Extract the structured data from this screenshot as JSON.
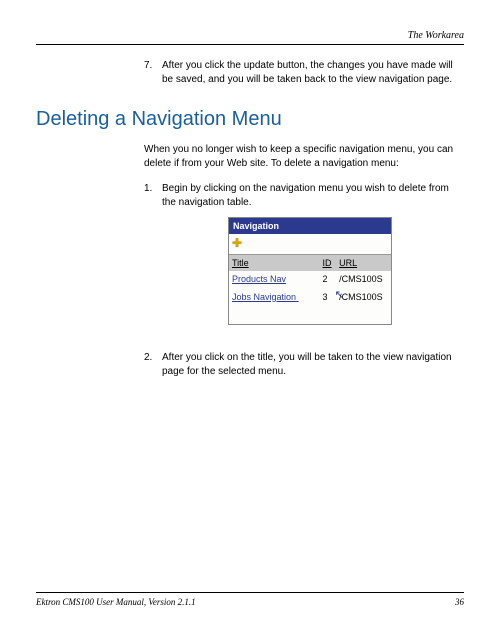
{
  "header": {
    "right_title": "The Workarea"
  },
  "step7": {
    "num": "7.",
    "text": "After you click the update button, the changes you have made will be saved, and you will be taken back to the view navigation page."
  },
  "heading": "Deleting a Navigation Menu",
  "intro": "When you no longer wish to keep a specific navigation menu, you can delete if from your Web site. To delete a navigation menu:",
  "step1": {
    "num": "1.",
    "text": "Begin by clicking on the navigation menu you wish to delete from the navigation table."
  },
  "nav_panel": {
    "title": "Navigation",
    "columns": {
      "title": "Title",
      "id": "ID",
      "url": "URL"
    },
    "rows": [
      {
        "title": "Products Nav",
        "id": "2",
        "url": "/CMS100S"
      },
      {
        "title": "Jobs Navigation",
        "id": "3",
        "url": "/CMS100S"
      }
    ]
  },
  "step2": {
    "num": "2.",
    "text": "After you click on the title, you will be taken to the view navigation page for the selected menu."
  },
  "footer": {
    "left": "Ektron CMS100 User Manual, Version 2.1.1",
    "page": "36"
  }
}
